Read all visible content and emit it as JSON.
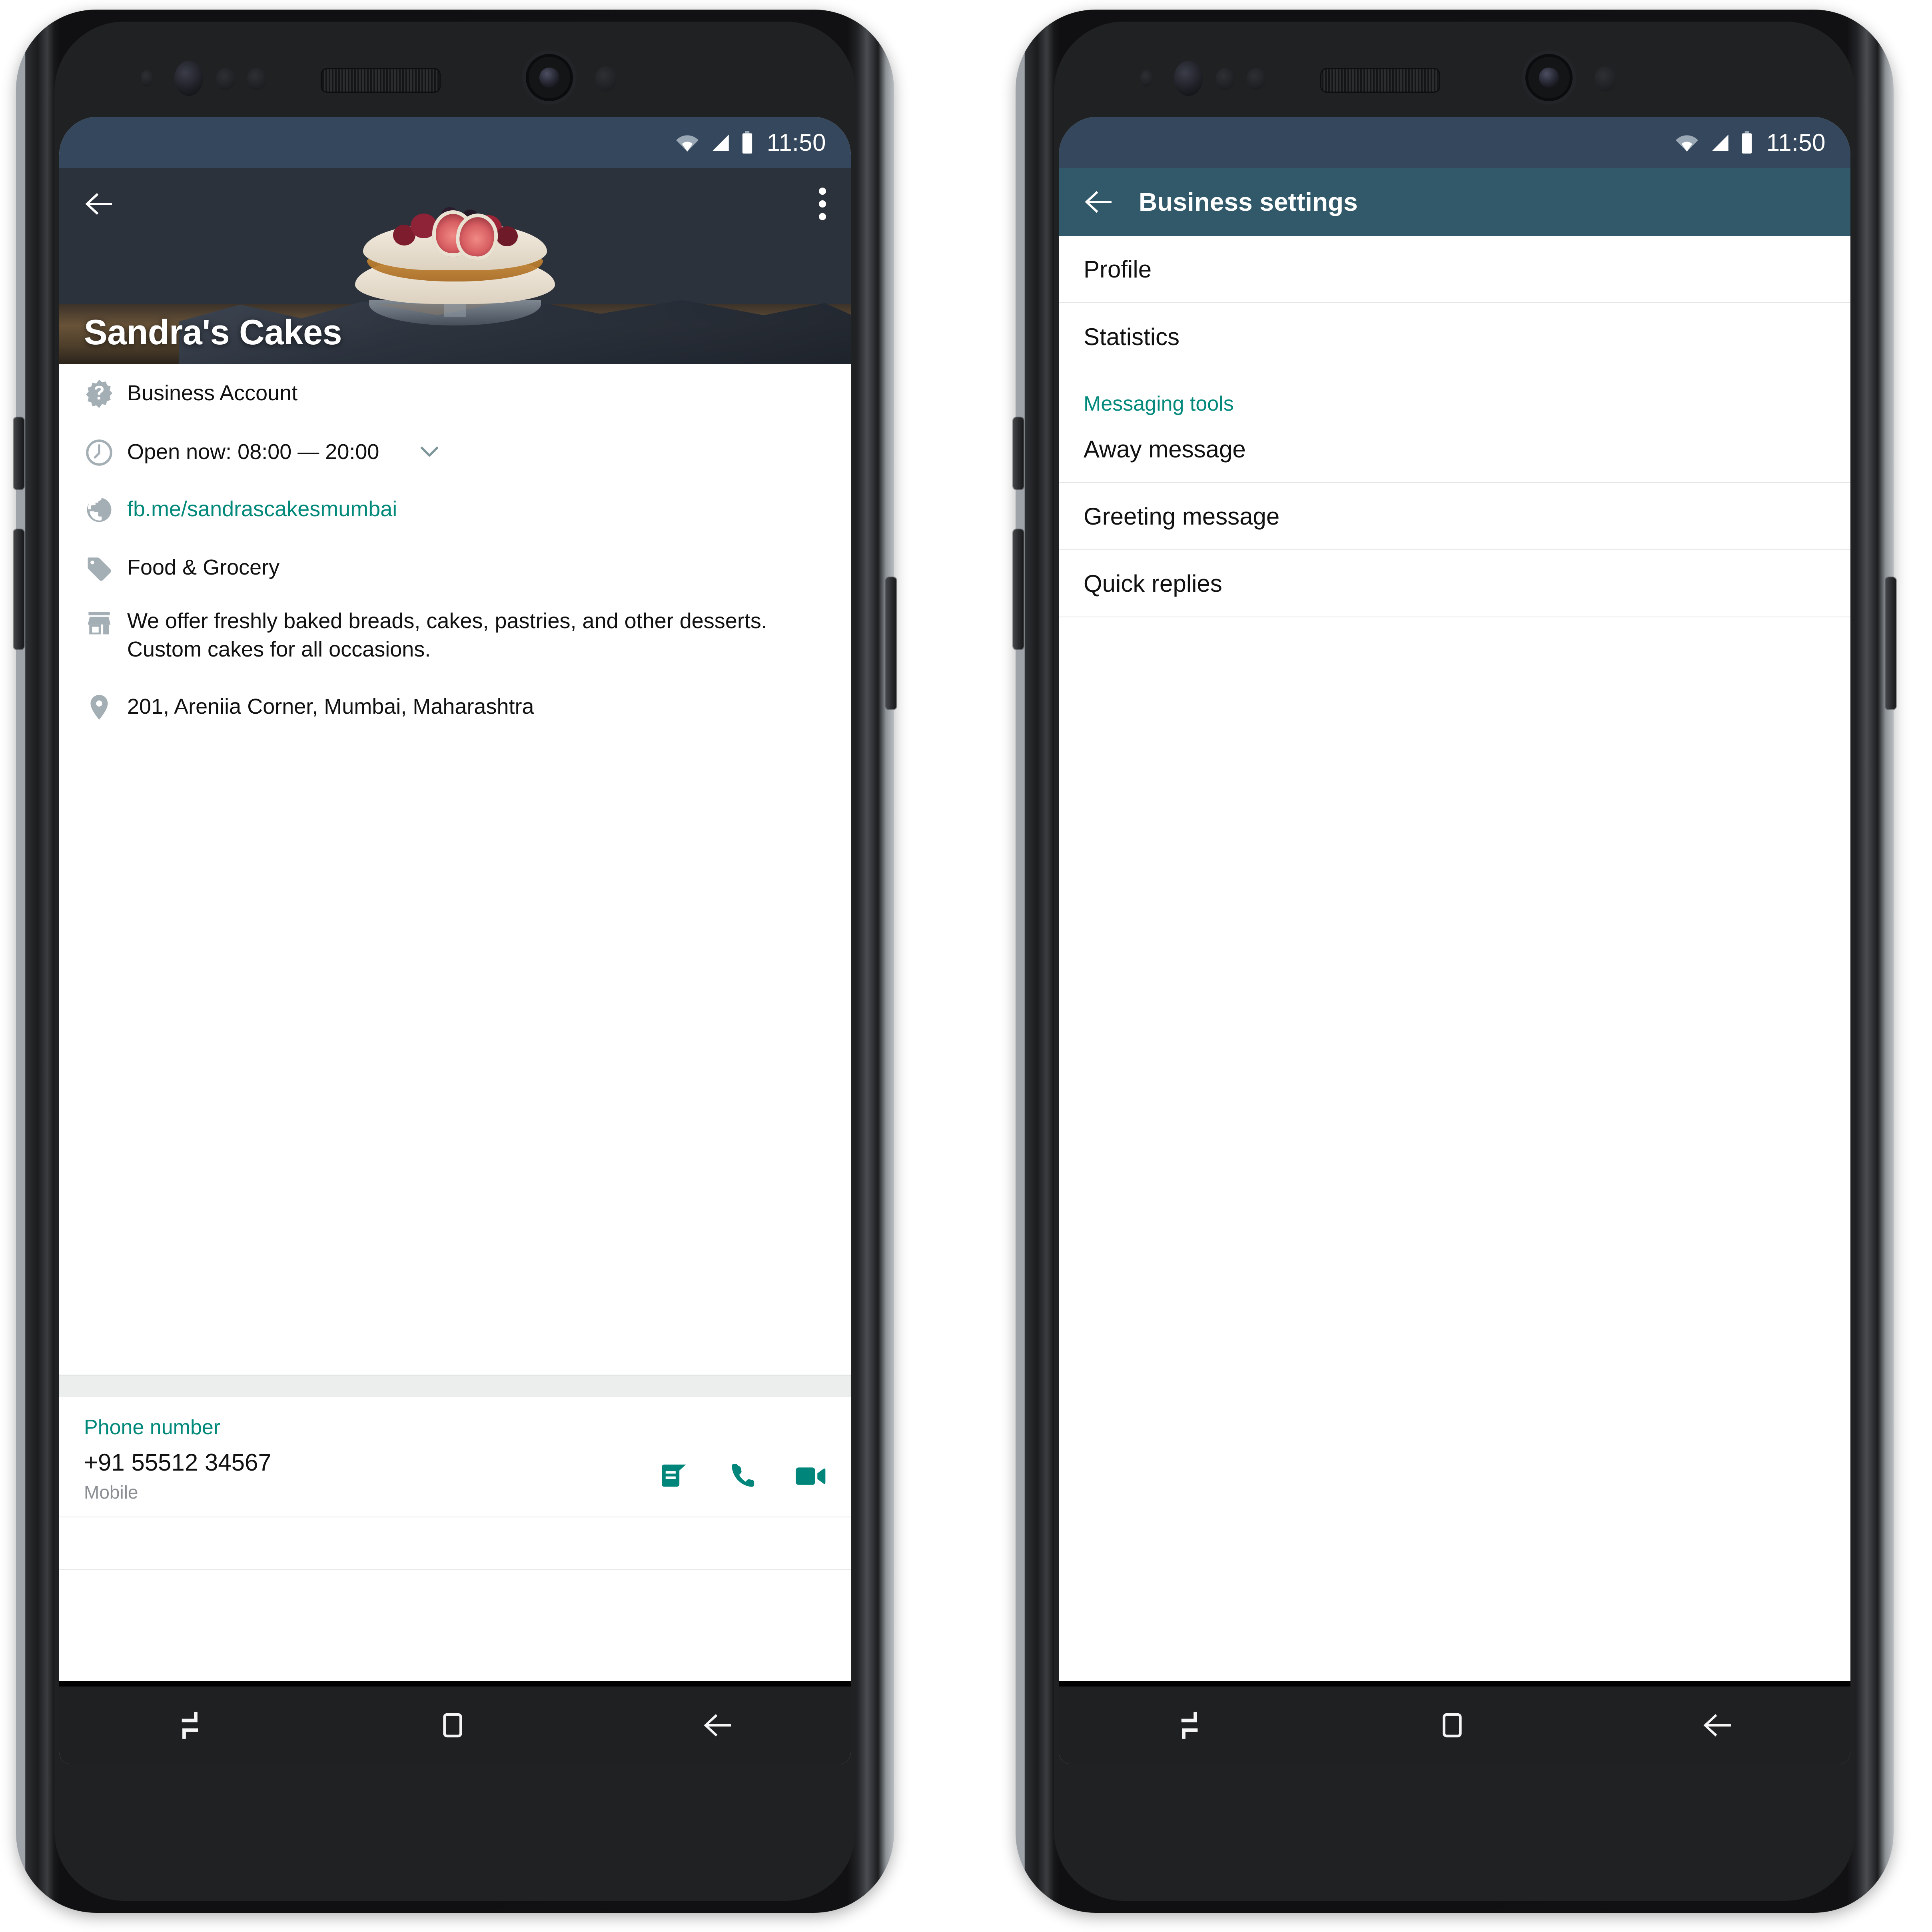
{
  "colors": {
    "status_bar": "#35475c",
    "app_bar": "#31596a",
    "accent_teal": "#00897b",
    "icon_gray": "#a4aeb5",
    "body_text": "#111111",
    "muted_text": "#8b8f93",
    "divider": "#e4e6e7",
    "band": "#eceded",
    "nav_bar": "#1f2022"
  },
  "status_bar": {
    "time": "11:50",
    "wifi_icon": "wifi-icon",
    "signal_icon": "cellular-signal-icon",
    "battery_icon": "battery-icon"
  },
  "left_phone": {
    "screen_name": "business-profile",
    "top_actions": {
      "back_icon": "back-arrow-icon",
      "overflow_icon": "more-options-icon"
    },
    "hero": {
      "business_name": "Sandra's Cakes",
      "photo_alt": "pavlova-cake-with-berries-and-figs"
    },
    "details": [
      {
        "icon": "verified-business-badge-icon",
        "text": "Business Account",
        "is_link": false
      },
      {
        "icon": "clock-icon",
        "text": "Open now: 08:00 — 20:00",
        "is_link": false,
        "expander_icon": "chevron-down-icon"
      },
      {
        "icon": "globe-icon",
        "text": "fb.me/sandrascakesmumbai",
        "is_link": true
      },
      {
        "icon": "tag-icon",
        "text": "Food & Grocery",
        "is_link": false
      },
      {
        "icon": "storefront-icon",
        "text": "We offer freshly baked breads, cakes, pastries, and other desserts. Custom cakes for all occasions.",
        "is_link": false
      },
      {
        "icon": "location-pin-icon",
        "text": "201, Areniia Corner, Mumbai, Maharashtra",
        "is_link": false
      }
    ],
    "phone_section": {
      "label": "Phone number",
      "number": "+91 55512 34567",
      "type": "Mobile",
      "actions": [
        {
          "icon": "message-icon",
          "name": "message-action"
        },
        {
          "icon": "call-icon",
          "name": "voice-call-action"
        },
        {
          "icon": "video-call-icon",
          "name": "video-call-action"
        }
      ]
    }
  },
  "right_phone": {
    "screen_name": "business-settings",
    "app_bar": {
      "back_icon": "back-arrow-icon",
      "title": "Business settings"
    },
    "items": [
      {
        "label": "Profile",
        "group": null
      },
      {
        "label": "Statistics",
        "group": null
      }
    ],
    "group": {
      "label": "Messaging tools",
      "items": [
        {
          "label": "Away message"
        },
        {
          "label": "Greeting message"
        },
        {
          "label": "Quick replies"
        }
      ]
    }
  },
  "nav_bar": {
    "recents_icon": "recents-icon",
    "home_icon": "home-icon",
    "back_icon": "back-arrow-icon"
  }
}
